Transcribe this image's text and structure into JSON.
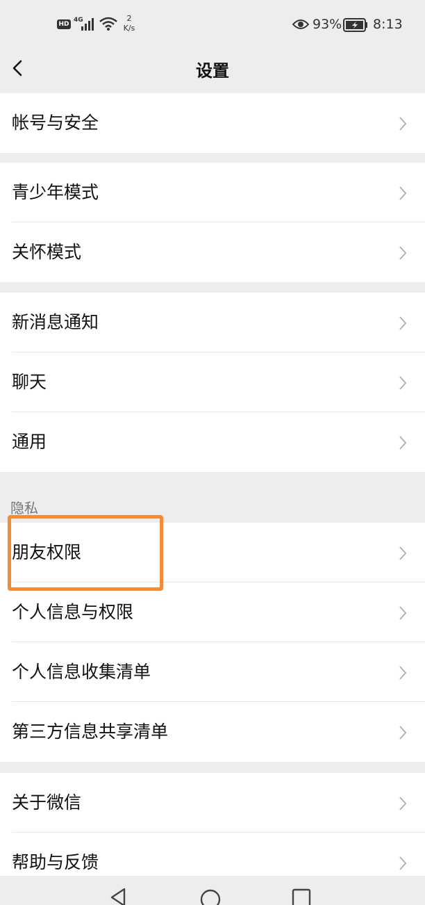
{
  "status_bar": {
    "hd": "HD",
    "network": "4G",
    "speed_value": "2",
    "speed_unit": "K/s",
    "battery_percent": "93%",
    "time": "8:13",
    "icons": [
      "hd-icon",
      "signal-icon",
      "wifi-icon",
      "eye-icon",
      "battery-icon"
    ]
  },
  "nav": {
    "title": "设置",
    "back_icon": "chevron-left-icon"
  },
  "groups": [
    {
      "items": [
        {
          "label": "帐号与安全"
        }
      ]
    },
    {
      "items": [
        {
          "label": "青少年模式"
        },
        {
          "label": "关怀模式"
        }
      ]
    },
    {
      "items": [
        {
          "label": "新消息通知"
        },
        {
          "label": "聊天"
        },
        {
          "label": "通用"
        }
      ]
    },
    {
      "header": "隐私",
      "items": [
        {
          "label": "朋友权限",
          "highlighted": true
        },
        {
          "label": "个人信息与权限"
        },
        {
          "label": "个人信息收集清单"
        },
        {
          "label": "第三方信息共享清单"
        }
      ]
    },
    {
      "items": [
        {
          "label": "关于微信"
        },
        {
          "label": "帮助与反馈"
        }
      ]
    }
  ],
  "highlight_color": "#f28c38",
  "system_nav": {
    "icons": [
      "back-triangle-icon",
      "home-circle-icon",
      "recents-square-icon"
    ]
  }
}
